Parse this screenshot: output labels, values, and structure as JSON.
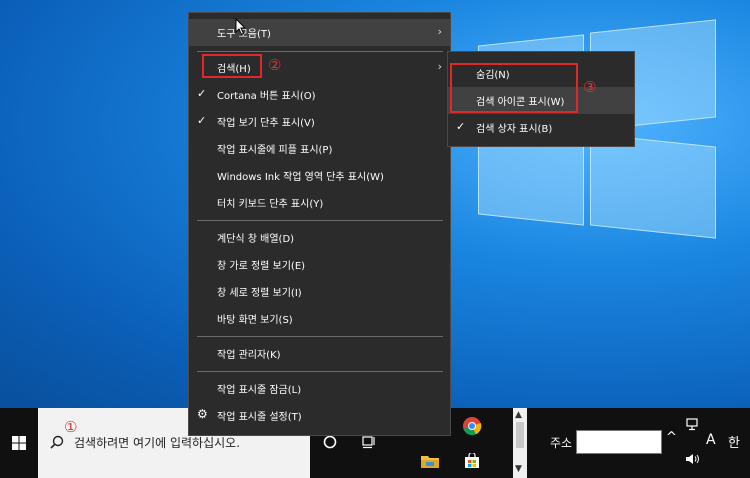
{
  "menu": {
    "items": [
      {
        "label": "도구 모음(T)",
        "checked": false,
        "submenu": true
      },
      {
        "label": "검색(H)",
        "checked": false,
        "submenu": true
      },
      {
        "label": "Cortana 버튼 표시(O)",
        "checked": true
      },
      {
        "label": "작업 보기 단추 표시(V)",
        "checked": true
      },
      {
        "label": "작업 표시줄에 피플 표시(P)",
        "checked": false
      },
      {
        "label": "Windows Ink 작업 영역 단추 표시(W)",
        "checked": false
      },
      {
        "label": "터치 키보드 단추 표시(Y)",
        "checked": false
      },
      {
        "label": "계단식 창 배열(D)",
        "checked": false
      },
      {
        "label": "창 가로 정렬 보기(E)",
        "checked": false
      },
      {
        "label": "창 세로 정렬 보기(I)",
        "checked": false
      },
      {
        "label": "바탕 화면 보기(S)",
        "checked": false
      },
      {
        "label": "작업 관리자(K)",
        "checked": false
      },
      {
        "label": "작업 표시줄 잠금(L)",
        "checked": false
      },
      {
        "label": "작업 표시줄 설정(T)",
        "checked": false,
        "icon": "gear-icon"
      }
    ]
  },
  "submenu": {
    "items": [
      {
        "label": "숨김(N)",
        "checked": false
      },
      {
        "label": "검색 아이콘 표시(W)",
        "checked": false
      },
      {
        "label": "검색 상자 표시(B)",
        "checked": true
      }
    ]
  },
  "annotations": {
    "step1": "①",
    "step2": "②",
    "step3": "③"
  },
  "taskbar": {
    "search_placeholder": "검색하려면 여기에 입력하십시오.",
    "address_label": "주소",
    "ime_label": "A",
    "ime_lang": "한"
  },
  "glyphs": {
    "check": "✓",
    "arrow": "›",
    "chevron_up": "^"
  },
  "colors": {
    "menu_bg": "#2b2b2b",
    "highlight": "#414141",
    "annotation_red": "#e02828"
  }
}
